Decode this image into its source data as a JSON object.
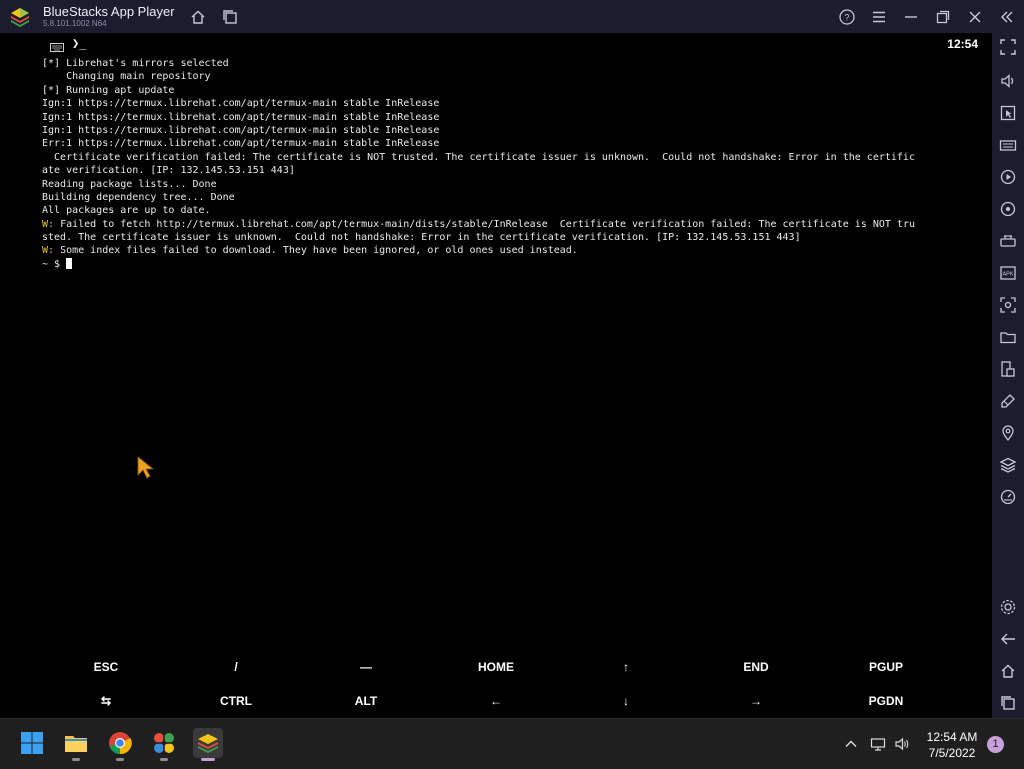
{
  "window": {
    "title": "BlueStacks App Player",
    "version": "5.8.101.1002 N64"
  },
  "status_bar": {
    "time": "12:54",
    "prompt_glyph": "❯_"
  },
  "terminal": {
    "lines": [
      {
        "text": "[*] Librehat's mirrors selected"
      },
      {
        "text": "    Changing main repository"
      },
      {
        "text": "[*] Running apt update"
      },
      {
        "text": "Ign:1 https://termux.librehat.com/apt/termux-main stable InRelease"
      },
      {
        "text": "Ign:1 https://termux.librehat.com/apt/termux-main stable InRelease"
      },
      {
        "text": "Ign:1 https://termux.librehat.com/apt/termux-main stable InRelease"
      },
      {
        "text": "Err:1 https://termux.librehat.com/apt/termux-main stable InRelease"
      },
      {
        "text": "  Certificate verification failed: The certificate is NOT trusted. The certificate issuer is unknown.  Could not handshake: Error in the certific"
      },
      {
        "text": "ate verification. [IP: 132.145.53.151 443]"
      },
      {
        "text": "Reading package lists... Done"
      },
      {
        "text": "Building dependency tree... Done"
      },
      {
        "text": "All packages are up to date."
      },
      {
        "prefix": "W:",
        "text": " Failed to fetch http://termux.librehat.com/apt/termux-main/dists/stable/InRelease  Certificate verification failed: The certificate is NOT tru"
      },
      {
        "text": "sted. The certificate issuer is unknown.  Could not handshake: Error in the certificate verification. [IP: 132.145.53.151 443]"
      },
      {
        "prefix": "W:",
        "text": " Some index files failed to download. They have been ignored, or old ones used instead."
      }
    ],
    "prompt": "~ $ "
  },
  "extra_keys": {
    "row1": [
      "ESC",
      "/",
      "—",
      "HOME",
      "↑",
      "END",
      "PGUP"
    ],
    "row2": [
      "⇆",
      "CTRL",
      "ALT",
      "←",
      "↓",
      "→",
      "PGDN"
    ]
  },
  "taskbar": {
    "time": "12:54 AM",
    "date": "7/5/2022",
    "notification_count": "1"
  },
  "colors": {
    "warning": "#e8c23a",
    "chrome_bg": "#1b1d2e",
    "taskbar_bg": "#1f1f1f"
  }
}
